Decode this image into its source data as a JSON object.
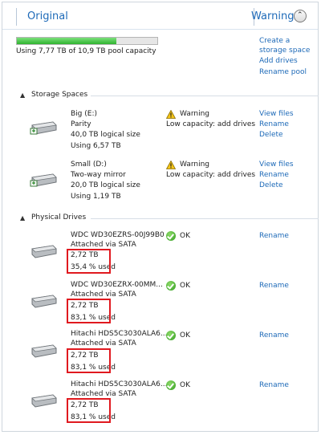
{
  "header": {
    "title": "Original",
    "status": "Warning"
  },
  "pool": {
    "usage_text": "Using 7,77 TB of 10,9 TB pool capacity",
    "used_fraction": 0.71
  },
  "actions": [
    "Create a",
    "storage space",
    "Add drives",
    "Rename pool"
  ],
  "storage_section": {
    "label": "Storage Spaces"
  },
  "spaces": [
    {
      "name": "Big (E:)",
      "type": "Parity",
      "size": "40,0 TB logical size",
      "using": "Using 6,57 TB",
      "status": "Warning",
      "status_detail": "Low capacity: add drives",
      "links": [
        "View files",
        "Rename",
        "Delete"
      ]
    },
    {
      "name": "Small (D:)",
      "type": "Two-way mirror",
      "size": "20,0 TB logical size",
      "using": "Using 1,19 TB",
      "status": "Warning",
      "status_detail": "Low capacity: add drives",
      "links": [
        "View files",
        "Rename",
        "Delete"
      ]
    }
  ],
  "physical_section": {
    "label": "Physical Drives"
  },
  "drives": [
    {
      "model": "WDC WD30EZRS-00J99B0",
      "connection": "Attached via SATA",
      "capacity": "2,72 TB",
      "used": "35,4 % used",
      "status": "OK",
      "link": "Rename"
    },
    {
      "model": "WDC WD30EZRX-00MM...",
      "connection": "Attached via SATA",
      "capacity": "2,72 TB",
      "used": "83,1 % used",
      "status": "OK",
      "link": "Rename"
    },
    {
      "model": "Hitachi HDS5C3030ALA6...",
      "connection": "Attached via SATA",
      "capacity": "2,72 TB",
      "used": "83,1 % used",
      "status": "OK",
      "link": "Rename"
    },
    {
      "model": "Hitachi HDS5C3030ALA6...",
      "connection": "Attached via SATA",
      "capacity": "2,72 TB",
      "used": "83,1 % used",
      "status": "OK",
      "link": "Rename"
    }
  ],
  "colors": {
    "accent": "#1e6ab8",
    "highlight_box": "#e0191f",
    "bar_fill": "#2fb32f"
  },
  "icons": {
    "collapse": "chevron-up-icon",
    "warning": "warning-triangle-icon",
    "ok": "ok-check-icon",
    "drive": "hard-drive-icon"
  }
}
